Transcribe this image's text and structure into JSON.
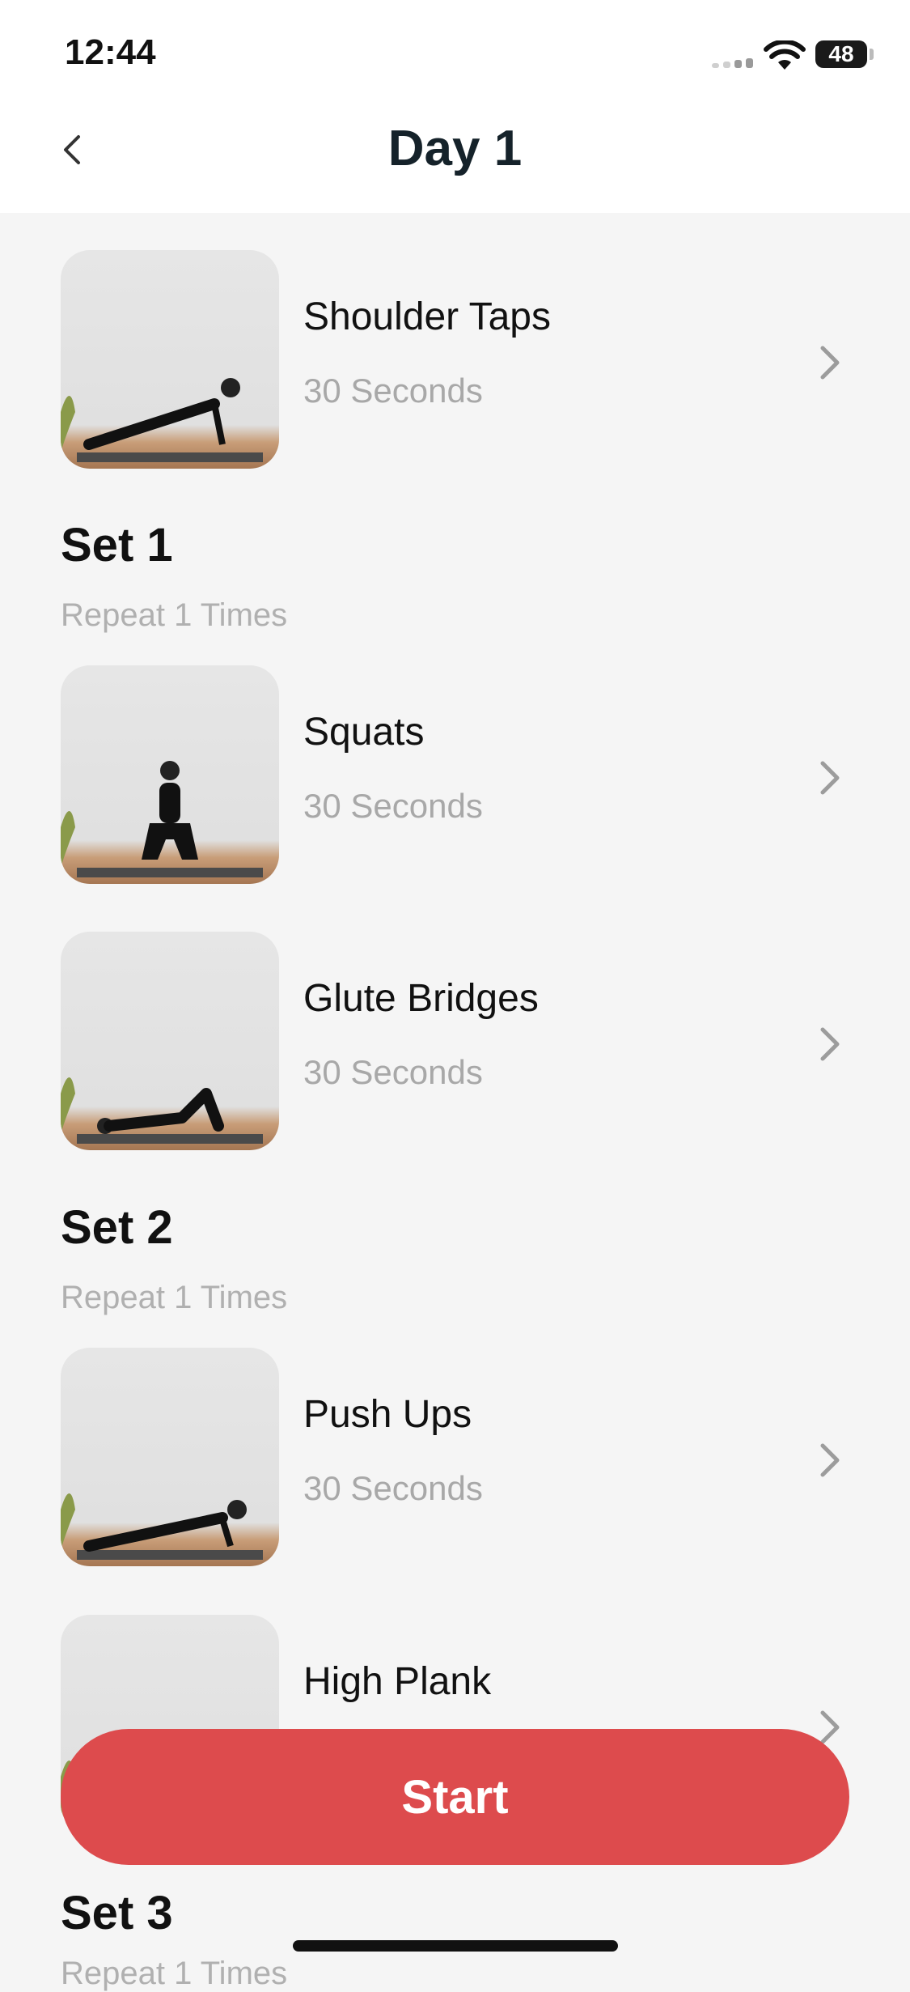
{
  "status_bar": {
    "time": "12:44",
    "battery": "48"
  },
  "header": {
    "title": "Day 1"
  },
  "warmup": {
    "name": "Shoulder Taps",
    "duration": "30 Seconds"
  },
  "sets": [
    {
      "title": "Set 1",
      "repeat": "Repeat 1 Times",
      "exercises": [
        {
          "name": "Squats",
          "duration": "30 Seconds"
        },
        {
          "name": "Glute Bridges",
          "duration": "30 Seconds"
        }
      ]
    },
    {
      "title": "Set 2",
      "repeat": "Repeat 1 Times",
      "exercises": [
        {
          "name": "Push Ups",
          "duration": "30 Seconds"
        },
        {
          "name": "High Plank",
          "duration": ""
        }
      ]
    },
    {
      "title": "Set 3",
      "repeat": "Repeat 1 Times"
    }
  ],
  "actions": {
    "start_label": "Start"
  },
  "colors": {
    "accent": "#dd4b4d",
    "title": "#15222a",
    "muted": "#a8a8a8"
  },
  "icons": {
    "back": "chevron-left-icon",
    "row": "chevron-right-icon"
  }
}
